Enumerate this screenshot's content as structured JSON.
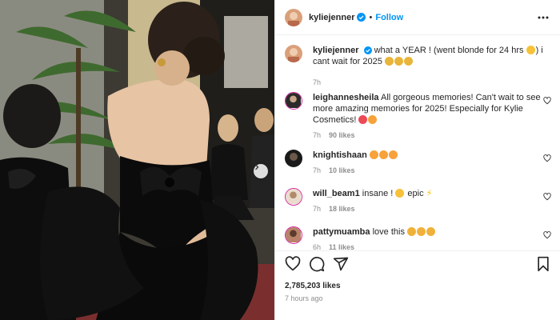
{
  "header": {
    "username": "kyliejenner",
    "separator": "•",
    "follow_label": "Follow"
  },
  "icons": {
    "verified": "verified-badge-icon",
    "more": "more-options-icon",
    "like": "heart-icon",
    "comment": "comment-icon",
    "share": "share-icon",
    "save": "bookmark-icon",
    "next": "chevron-right-icon"
  },
  "colors": {
    "accent": "#0095f6",
    "heart_red": "#ed4956",
    "muted": "#8e8e8e"
  },
  "caption": {
    "username": "kyliejenner",
    "text": "what a YEAR ! (went blonde for 24 hrs",
    "text_2": ") i cant wait for 2025",
    "time": "7h"
  },
  "comments": [
    {
      "username": "leighannesheila",
      "text": "All gorgeous memories! Can't wait to see more amazing memories for 2025! Especially for Kylie Cosmetics!",
      "time": "7h",
      "likes": "90 likes"
    },
    {
      "username": "knightishaan",
      "text": "",
      "time": "7h",
      "likes": "10 likes"
    },
    {
      "username": "will_beam1",
      "text": "insane !",
      "text_2": "epic",
      "time": "7h",
      "likes": "18 likes"
    },
    {
      "username": "pattymuamba",
      "text": "love this",
      "time": "6h",
      "likes": "11 likes"
    }
  ],
  "footer": {
    "likes": "2,785,203 likes",
    "time_ago": "7 hours ago"
  }
}
